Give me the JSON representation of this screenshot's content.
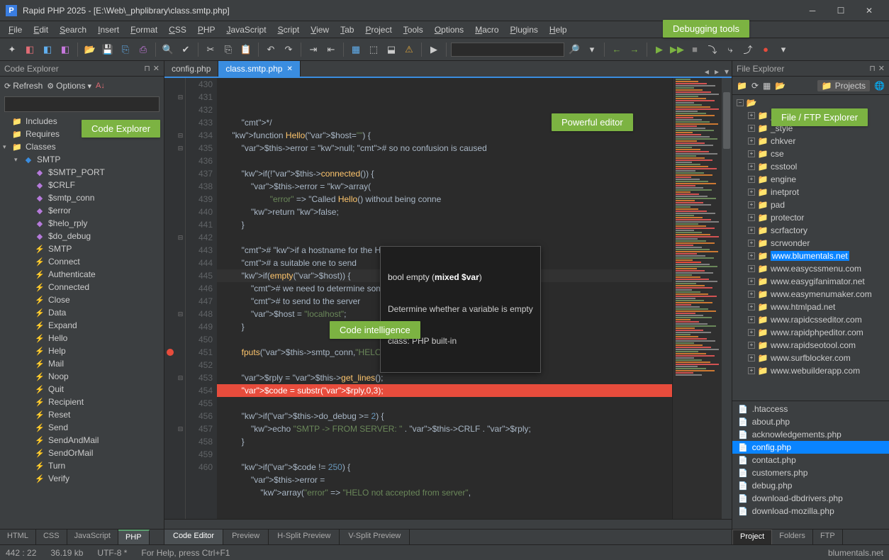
{
  "title": "Rapid PHP 2025 - [E:\\Web\\_phplibrary\\class.smtp.php]",
  "menus": [
    "File",
    "Edit",
    "Search",
    "Insert",
    "Format",
    "CSS",
    "PHP",
    "JavaScript",
    "Script",
    "View",
    "Tab",
    "Project",
    "Tools",
    "Options",
    "Macro",
    "Plugins",
    "Help"
  ],
  "callouts": {
    "debugging": "Debugging tools",
    "powerful": "Powerful editor",
    "intelligence": "Code intelligence",
    "explorer": "Code Explorer",
    "fileftp": "File / FTP Explorer"
  },
  "left": {
    "title": "Code Explorer",
    "refresh": "Refresh",
    "options": "Options",
    "folders": [
      "Includes",
      "Requires",
      "Classes"
    ],
    "class_name": "SMTP",
    "vars": [
      "$SMTP_PORT",
      "$CRLF",
      "$smtp_conn",
      "$error",
      "$helo_rply",
      "$do_debug"
    ],
    "methods": [
      "SMTP",
      "Connect",
      "Authenticate",
      "Connected",
      "Close",
      "Data",
      "Expand",
      "Hello",
      "Help",
      "Mail",
      "Noop",
      "Quit",
      "Recipient",
      "Reset",
      "Send",
      "SendAndMail",
      "SendOrMail",
      "Turn",
      "Verify"
    ],
    "lang_tabs": [
      "HTML",
      "CSS",
      "JavaScript",
      "PHP"
    ],
    "lang_active": 3
  },
  "tabs": [
    {
      "label": "config.php",
      "active": false
    },
    {
      "label": "class.smtp.php",
      "active": true
    }
  ],
  "line_start": 430,
  "line_count": 31,
  "breakpoint_line": 451,
  "current_line": 442,
  "code_lines": [
    "        */",
    "    function Hello($host=\"\") {",
    "        $this->error = null; # so no confusion is caused",
    "",
    "        if(!$this->connected()) {",
    "            $this->error = array(",
    "                    \"error\" => \"Called Hello() without being conne",
    "            return false;",
    "        }",
    "",
    "        # if a hostname for the HELO wasn't specified determine",
    "        # a suitable one to send",
    "        if(empty($host)) {",
    "            # we need to determine some sort of appopiate default",
    "            # to send to the server",
    "            $host = \"localhost\";",
    "        }",
    "",
    "        fputs($this->smtp_conn,\"HELO \" . $host . $this->CRLF);",
    "",
    "        $rply = $this->get_lines();",
    "        $code = substr($rply,0,3);",
    "",
    "        if($this->do_debug >= 2) {",
    "            echo \"SMTP -> FROM SERVER: \" . $this->CRLF . $rply;",
    "        }",
    "",
    "        if($code != 250) {",
    "            $this->error =",
    "                array(\"error\" => \"HELO not accepted from server\",",
    ""
  ],
  "tooltip": {
    "sig": "bool empty (mixed $var)",
    "desc": "Determine whether a variable is empty",
    "class": "class: PHP built-in"
  },
  "bottom_tabs": [
    "Code Editor",
    "Preview",
    "H-Split Preview",
    "V-Split Preview"
  ],
  "right": {
    "title": "File Explorer",
    "projects_label": "Projects",
    "folders": [
      {
        "name": "_script",
        "c": "green"
      },
      {
        "name": "_style",
        "c": "green"
      },
      {
        "name": "chkver",
        "c": "green"
      },
      {
        "name": "cse",
        "c": "green"
      },
      {
        "name": "csstool",
        "c": "green"
      },
      {
        "name": "engine",
        "c": "green"
      },
      {
        "name": "inetprot",
        "c": "green"
      },
      {
        "name": "pad",
        "c": "green"
      },
      {
        "name": "protector",
        "c": "green"
      },
      {
        "name": "scrfactory",
        "c": "green"
      },
      {
        "name": "scrwonder",
        "c": "green"
      },
      {
        "name": "www.blumentals.net",
        "c": "green",
        "selected": true
      },
      {
        "name": "www.easycssmenu.com",
        "c": "green"
      },
      {
        "name": "www.easygifanimator.net",
        "c": "green"
      },
      {
        "name": "www.easymenumaker.com",
        "c": "green"
      },
      {
        "name": "www.htmlpad.net",
        "c": "red"
      },
      {
        "name": "www.rapidcsseditor.com",
        "c": "red"
      },
      {
        "name": "www.rapidphpeditor.com",
        "c": "red"
      },
      {
        "name": "www.rapidseotool.com",
        "c": "green"
      },
      {
        "name": "www.surfblocker.com",
        "c": "green"
      },
      {
        "name": "www.webuilderapp.com",
        "c": "red"
      }
    ],
    "files": [
      ".htaccess",
      "about.php",
      "acknowledgements.php",
      "config.php",
      "contact.php",
      "customers.php",
      "debug.php",
      "download-dbdrivers.php",
      "download-mozilla.php"
    ],
    "file_selected": 3,
    "bottom_tabs": [
      "Project",
      "Folders",
      "FTP"
    ]
  },
  "status": {
    "pos": "442 : 22",
    "size": "36.19 kb",
    "enc": "UTF-8 *",
    "help": "For Help, press Ctrl+F1",
    "site": "blumentals.net"
  }
}
